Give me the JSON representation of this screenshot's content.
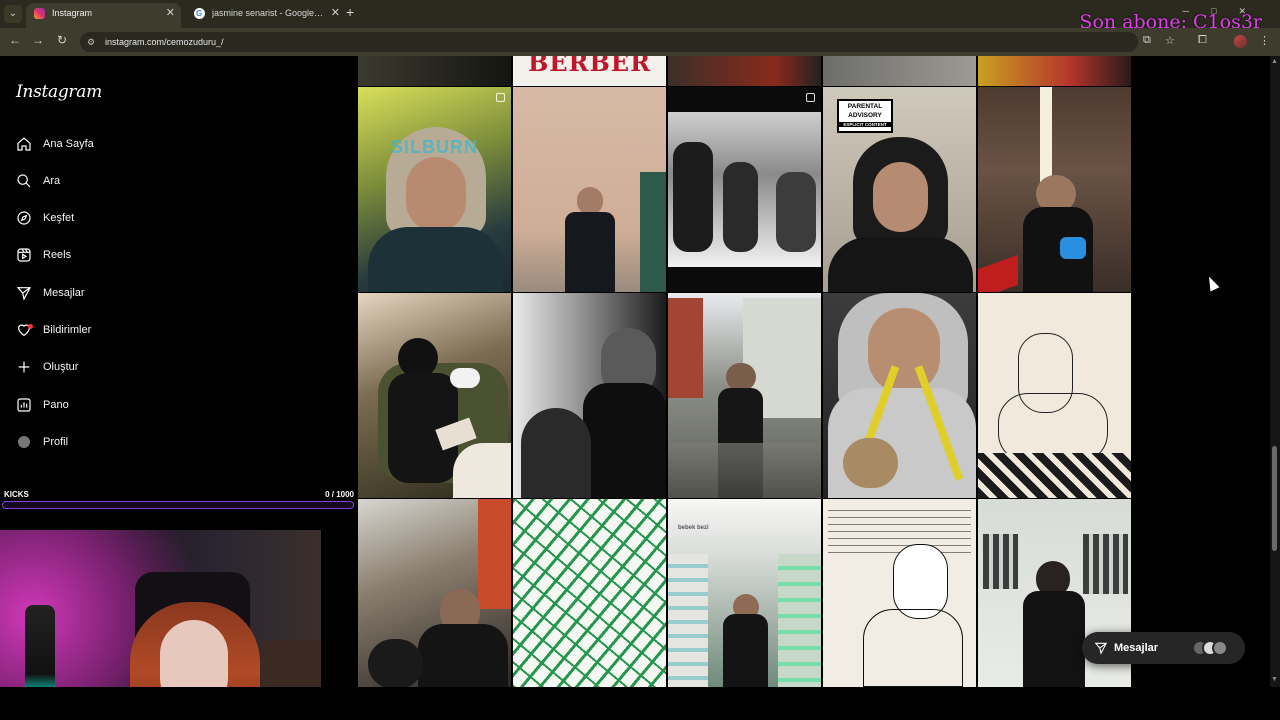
{
  "browser": {
    "tabs": [
      {
        "title": "Instagram",
        "favicon": "instagram-icon",
        "active": true
      },
      {
        "title": "jasmine senarist - Google'da Ara",
        "favicon": "google-icon",
        "active": false
      }
    ],
    "url": "instagram.com/cemozuduru_/"
  },
  "overlay": {
    "subscriber_text": "Son abone: C1os3r",
    "color": "#e040e8"
  },
  "sidebar": {
    "logo": "Instagram",
    "items": [
      {
        "label": "Ana Sayfa",
        "icon": "home-icon"
      },
      {
        "label": "Ara",
        "icon": "search-icon"
      },
      {
        "label": "Keşfet",
        "icon": "compass-icon"
      },
      {
        "label": "Reels",
        "icon": "reels-icon"
      },
      {
        "label": "Mesajlar",
        "icon": "messenger-icon"
      },
      {
        "label": "Bildirimler",
        "icon": "heart-icon"
      },
      {
        "label": "Oluştur",
        "icon": "plus-icon"
      },
      {
        "label": "Pano",
        "icon": "dashboard-icon"
      },
      {
        "label": "Profil",
        "icon": "avatar"
      }
    ]
  },
  "kicks": {
    "label": "KICKS",
    "count": "0 / 1000",
    "progress": 0,
    "accent": "#b55bff"
  },
  "grid": {
    "top_strip_text": "BERBER",
    "posts": [
      {
        "caption": "SILBURN",
        "multi": true
      },
      {
        "caption": "",
        "multi": false
      },
      {
        "caption": "",
        "multi": true
      },
      {
        "caption": "PARENTAL ADVISORY",
        "caption2": "EXPLICIT CONTENT",
        "multi": false
      },
      {
        "caption": "",
        "multi": false
      },
      {
        "caption": "",
        "multi": false
      },
      {
        "caption": "",
        "multi": false
      },
      {
        "caption": "",
        "multi": false
      },
      {
        "caption": "",
        "multi": false
      },
      {
        "caption": "",
        "multi": false
      },
      {
        "caption": "",
        "multi": false
      },
      {
        "caption": "",
        "multi": false
      },
      {
        "caption": "bebek bezi",
        "multi": false
      },
      {
        "caption": "",
        "multi": false
      },
      {
        "caption": "",
        "multi": false
      }
    ]
  },
  "messages_button": {
    "label": "Mesajlar",
    "icon": "messenger-icon"
  }
}
